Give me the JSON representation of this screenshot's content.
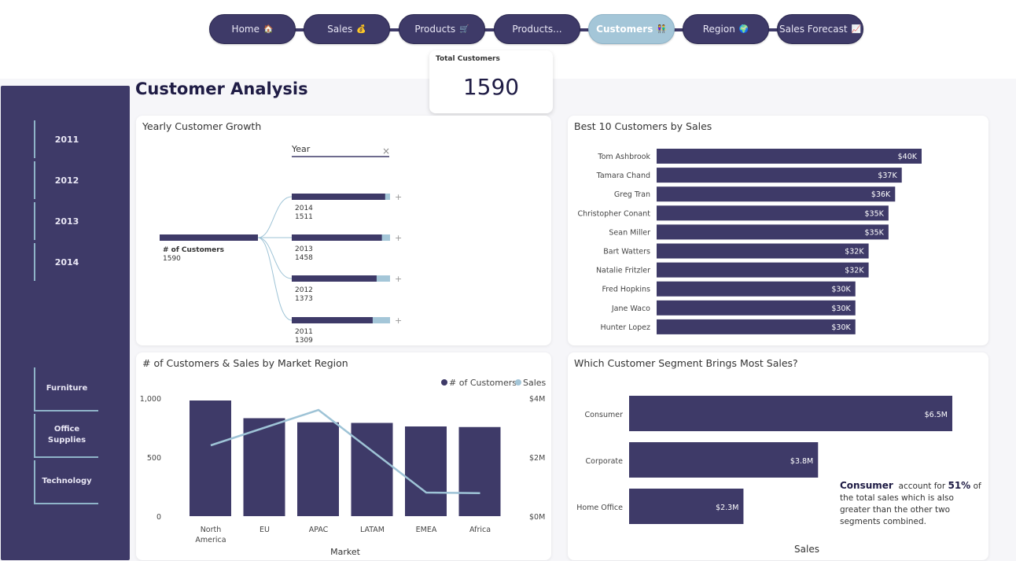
{
  "nav": {
    "items": [
      {
        "label": "Home",
        "icon": "house-icon",
        "glyph": "🏠"
      },
      {
        "label": "Sales",
        "icon": "money-bag-icon",
        "glyph": "💰"
      },
      {
        "label": "Products",
        "icon": "cart-icon",
        "glyph": "🛒"
      },
      {
        "label": "Products...",
        "icon": "",
        "glyph": ""
      },
      {
        "label": "Customers",
        "icon": "people-icon",
        "glyph": "👫",
        "active": true
      },
      {
        "label": "Region",
        "icon": "globe-icon",
        "glyph": "🌍"
      },
      {
        "label": "Sales Forecast",
        "icon": "chart-icon",
        "glyph": "📈"
      }
    ]
  },
  "page": {
    "title": "Customer Analysis"
  },
  "kpi": {
    "label": "Total Customers",
    "value": "1590"
  },
  "sidebar": {
    "years": [
      "2011",
      "2012",
      "2013",
      "2014"
    ],
    "categories": [
      "Furniture",
      "Office Supplies",
      "Technology"
    ]
  },
  "colors": {
    "primary": "#3e3a68",
    "accent": "#a4c6d8",
    "line": "#9ec3d6"
  },
  "panels": {
    "growth": {
      "title": "Yearly Customer Growth",
      "field": "Year",
      "clear_icon": "×",
      "expand_icon": "+"
    },
    "top10": {
      "title": "Best 10 Customers by Sales"
    },
    "market": {
      "title": "# of Customers & Sales by Market Region"
    },
    "segment": {
      "title": "Which Customer Segment Brings Most Sales?",
      "callout_bold": "Consumer",
      "callout_text": "account for",
      "callout_pct": "51%",
      "callout_rest": "of the total sales which is also greater than the other two segments combined."
    }
  },
  "chart_data": [
    {
      "type": "decomposition-tree",
      "title": "Yearly Customer Growth",
      "root": {
        "label": "# of Customers",
        "value": 1590
      },
      "level_label": "Year",
      "nodes": [
        {
          "label": "2014",
          "value": 1511
        },
        {
          "label": "2013",
          "value": 1458
        },
        {
          "label": "2012",
          "value": 1373
        },
        {
          "label": "2011",
          "value": 1309
        }
      ]
    },
    {
      "type": "bar",
      "orientation": "horizontal",
      "title": "Best 10 Customers by Sales",
      "categories": [
        "Tom Ashbrook",
        "Tamara Chand",
        "Greg Tran",
        "Christopher Conant",
        "Sean Miller",
        "Bart Watters",
        "Natalie Fritzler",
        "Fred Hopkins",
        "Jane Waco",
        "Hunter Lopez"
      ],
      "values": [
        40,
        37,
        36,
        35,
        35,
        32,
        32,
        30,
        30,
        30
      ],
      "data_labels": [
        "$40K",
        "$37K",
        "$36K",
        "$35K",
        "$35K",
        "$32K",
        "$32K",
        "$30K",
        "$30K",
        "$30K"
      ]
    },
    {
      "type": "bar",
      "title": "# of Customers & Sales by Market Region",
      "xlabel": "Market",
      "categories": [
        "North America",
        "EU",
        "APAC",
        "LATAM",
        "EMEA",
        "Africa"
      ],
      "series": [
        {
          "name": "# of Customers",
          "type": "bar",
          "axis": "left",
          "values": [
            980,
            830,
            795,
            790,
            760,
            755
          ]
        },
        {
          "name": "Sales",
          "type": "line",
          "axis": "right",
          "values": [
            2.4,
            3.0,
            3.6,
            2.2,
            0.8,
            0.78
          ]
        }
      ],
      "ylim_left": [
        0,
        1000
      ],
      "ylim_right": [
        0,
        4
      ],
      "left_ticks": [
        "0",
        "500",
        "1,000"
      ],
      "right_ticks": [
        "$0M",
        "$2M",
        "$4M"
      ],
      "legend": "top-right"
    },
    {
      "type": "bar",
      "orientation": "horizontal",
      "title": "Which Customer Segment Brings Most Sales?",
      "xlabel": "Sales",
      "categories": [
        "Consumer",
        "Corporate",
        "Home Office"
      ],
      "values": [
        6.5,
        3.8,
        2.3
      ],
      "data_labels": [
        "$6.5M",
        "$3.8M",
        "$2.3M"
      ]
    }
  ]
}
